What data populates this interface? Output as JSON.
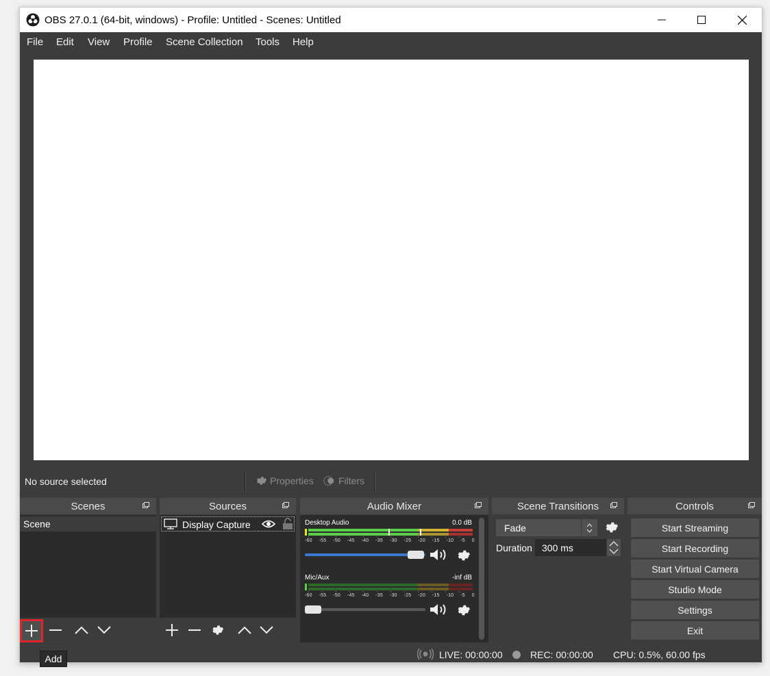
{
  "window": {
    "title": "OBS 27.0.1 (64-bit, windows) - Profile: Untitled - Scenes: Untitled",
    "controls": [
      "minimize-icon",
      "maximize-icon",
      "close-icon"
    ]
  },
  "menu": [
    "File",
    "Edit",
    "View",
    "Profile",
    "Scene Collection",
    "Tools",
    "Help"
  ],
  "context_bar": {
    "label": "No source selected",
    "properties": "Properties",
    "filters": "Filters"
  },
  "docks": {
    "scenes": {
      "title": "Scenes",
      "items": [
        "Scene"
      ]
    },
    "sources": {
      "title": "Sources",
      "items": [
        {
          "name": "Display Capture",
          "visible": true,
          "locked": false
        }
      ]
    },
    "audio_mixer": {
      "title": "Audio Mixer",
      "channels": [
        {
          "name": "Desktop Audio",
          "db": "0.0 dB",
          "volume": 1.0,
          "muted": false
        },
        {
          "name": "Mic/Aux",
          "db": "-inf dB",
          "volume": 0.0,
          "muted": false
        }
      ],
      "scale": [
        "-60",
        "-55",
        "-50",
        "-45",
        "-40",
        "-35",
        "-30",
        "-25",
        "-20",
        "-15",
        "-10",
        "-5",
        "0"
      ]
    },
    "transitions": {
      "title": "Scene Transitions",
      "selected": "Fade",
      "duration_label": "Duration",
      "duration_value": "300 ms"
    },
    "controls": {
      "title": "Controls",
      "buttons": [
        "Start Streaming",
        "Start Recording",
        "Start Virtual Camera",
        "Studio Mode",
        "Settings",
        "Exit"
      ]
    }
  },
  "status": {
    "live": "LIVE: 00:00:00",
    "rec": "REC: 00:00:00",
    "cpu": "CPU: 0.5%, 60.00 fps"
  },
  "tooltip": "Add",
  "highlight_color": "#e0262b"
}
